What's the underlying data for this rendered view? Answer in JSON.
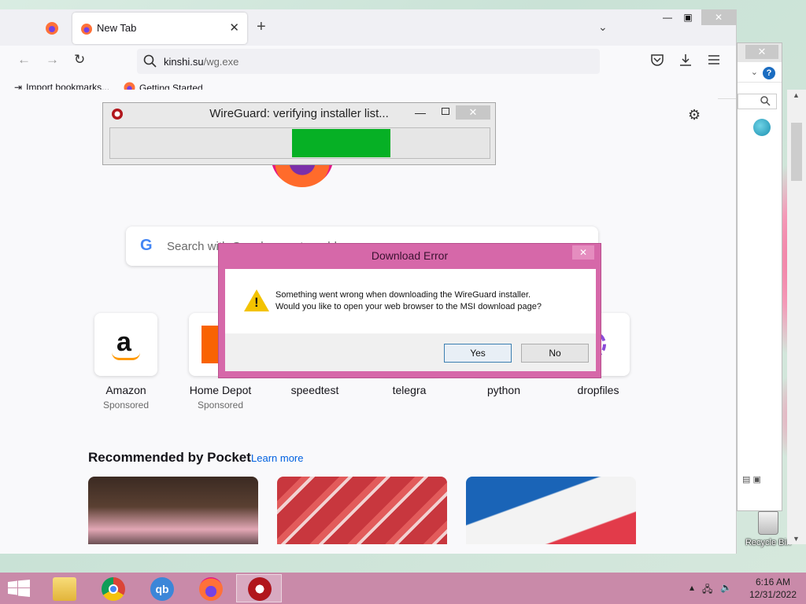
{
  "browser": {
    "tab_title": "New Tab",
    "url_host": "kinshi.su",
    "url_path": "/wg.exe",
    "bookmarks": [
      "Import bookmarks...",
      "Getting Started"
    ]
  },
  "newtab": {
    "search_placeholder": "Search with Google or enter address",
    "tiles": [
      {
        "name": "Amazon",
        "sponsored": "Sponsored"
      },
      {
        "name": "Home Depot",
        "sponsored": "Sponsored"
      },
      {
        "name": "speedtest",
        "sponsored": ""
      },
      {
        "name": "telegra",
        "sponsored": ""
      },
      {
        "name": "python",
        "sponsored": ""
      },
      {
        "name": "dropfiles",
        "sponsored": ""
      }
    ],
    "pocket_title": "Recommended by Pocket",
    "pocket_link": "Learn more"
  },
  "wireguard": {
    "title": "WireGuard: verifying installer list...",
    "progress_start": 0.48,
    "progress_end": 0.74,
    "progress_color": "#06b025"
  },
  "dialog": {
    "title": "Download Error",
    "message_line1": "Something went wrong when downloading the WireGuard installer.",
    "message_line2": "Would you like to open your web browser to the MSI download page?",
    "yes_label": "Yes",
    "no_label": "No",
    "icon": "warning-icon"
  },
  "desktop": {
    "recycle_bin": "Recycle Bin"
  },
  "taskbar": {
    "items": [
      "file-explorer-icon",
      "chrome-icon",
      "qbittorrent-icon",
      "firefox-icon",
      "wireguard-icon"
    ],
    "time": "6:16 AM",
    "date": "12/31/2022"
  },
  "colors": {
    "dialog_frame": "#d668a9",
    "taskbar": "#c98aa9"
  }
}
